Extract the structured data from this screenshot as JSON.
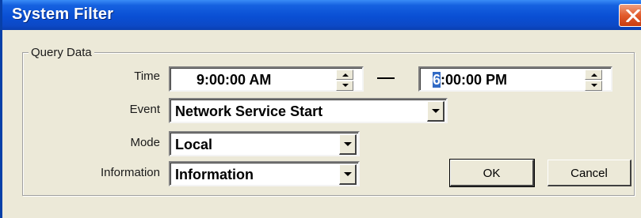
{
  "window": {
    "title": "System Filter"
  },
  "group": {
    "label": "Query Data"
  },
  "time": {
    "label": "Time",
    "start_value": "9:00:00 AM",
    "end_value_selected_digit": "6",
    "end_value_rest": ":00:00 PM"
  },
  "event": {
    "label": "Event",
    "value": "Network Service Start"
  },
  "mode": {
    "label": "Mode",
    "value": "Local"
  },
  "information": {
    "label": "Information",
    "value": "Information"
  },
  "buttons": {
    "ok": "OK",
    "cancel": "Cancel"
  },
  "icons": {
    "close": "close-icon",
    "spin_up": "spin-up-icon",
    "spin_down": "spin-down-icon",
    "dropdown": "chevron-down-icon"
  },
  "colors": {
    "titlebar": "#0a4fd4",
    "close": "#e25b2c",
    "face": "#ece9d8",
    "selection": "#316ac5"
  }
}
